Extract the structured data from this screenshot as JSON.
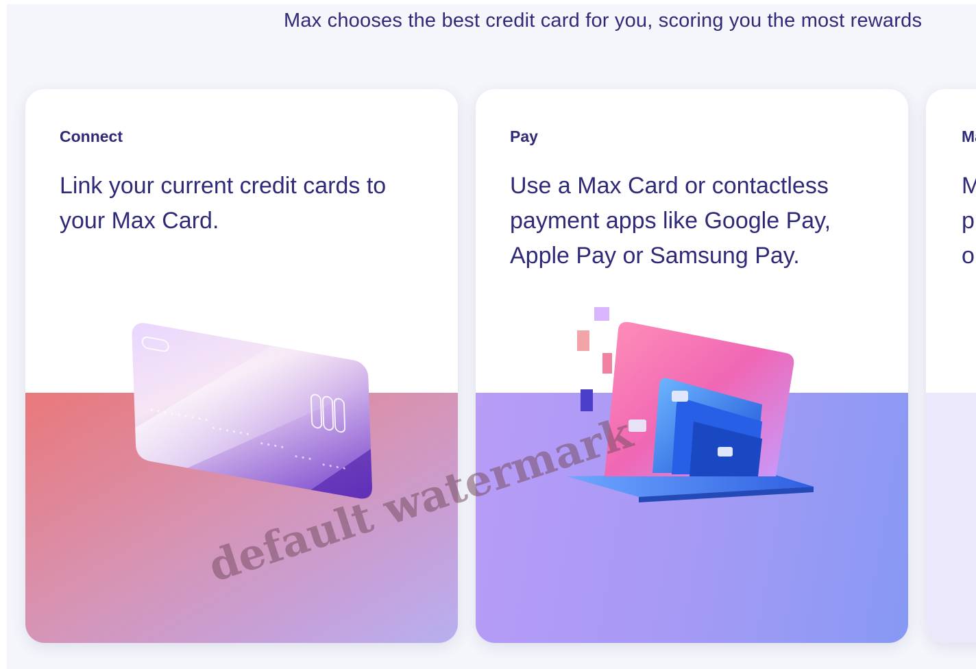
{
  "intro": "Max chooses the best credit card for you, scoring you the most rewards",
  "cards": [
    {
      "eyebrow": "Connect",
      "headline": "Link your current credit cards to your Max Card.",
      "illustration": "iridescent-credit-card"
    },
    {
      "eyebrow": "Pay",
      "headline": "Use a Max Card or contactless payment apps like Google Pay, Apple Pay or Samsung Pay.",
      "illustration": "payment-cards-stack"
    },
    {
      "eyebrow": "Ma",
      "headline": "M\np\no",
      "illustration": ""
    }
  ],
  "watermark": "default watermark",
  "colors": {
    "text": "#2e2a78",
    "background": "#f5f6fb",
    "connect_gradient_start": "#e9787a",
    "connect_gradient_end": "#b7b0f0",
    "pay_gradient_start": "#b89cf6",
    "pay_gradient_end": "#8799f3"
  }
}
